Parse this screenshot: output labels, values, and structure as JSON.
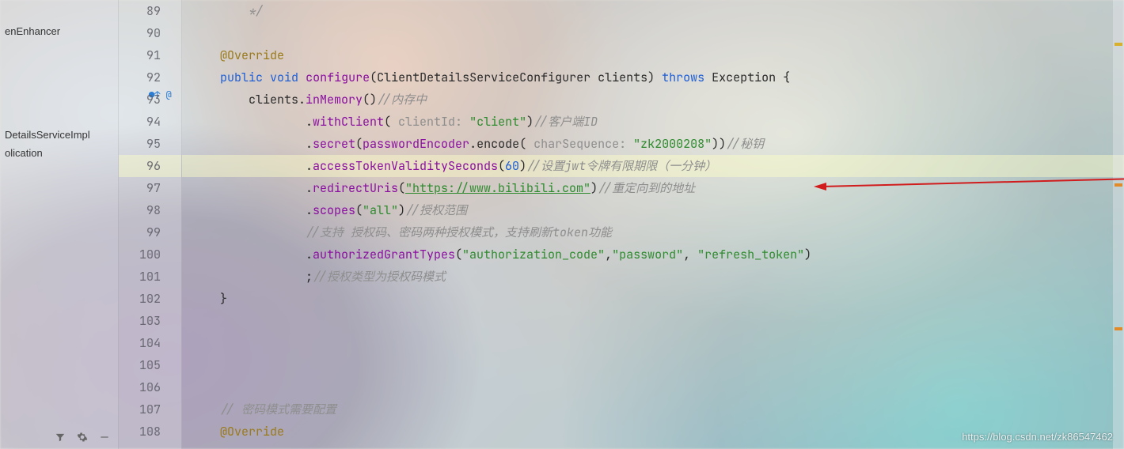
{
  "sidebar": {
    "items": [
      "enEnhancer",
      "DetailsServiceImpl",
      "olication"
    ]
  },
  "gutter": {
    "start": 89,
    "highlight": 96,
    "marks": "●↑ @"
  },
  "code": {
    "l89": "*/",
    "l91_ann": "@Override",
    "l92": {
      "kw1": "public",
      "kw2": "void",
      "mth": "configure",
      "sig": "(ClientDetailsServiceConfigurer clients)",
      "kw3": "throws",
      "exc": "Exception {"
    },
    "l93": {
      "pre": "clients.",
      "mth": "inMemory",
      "post": "()",
      "cmt": "//内存中"
    },
    "l94": {
      "mth": "withClient",
      "open": "( ",
      "param": "clientId:",
      "str": "\"client\"",
      "close": ")",
      "cmt": "//客户端ID"
    },
    "l95": {
      "mth": "secret",
      "open": "(",
      "inner": "passwordEncoder",
      "enc": ".encode( ",
      "param": "charSequence:",
      "str": "\"zk2000208\"",
      "close": "))",
      "cmt": "//秘钥"
    },
    "l96": {
      "mth": "accessTokenValiditySeconds",
      "open": "(",
      "num": "60",
      "close": ")",
      "cmt": "//设置jwt令牌有限期限（一分钟）"
    },
    "l97": {
      "mth": "redirectUris",
      "open": "(",
      "str": "\"https://www.bilibili.com\"",
      "close": ")",
      "cmt": "//重定向到的地址"
    },
    "l98": {
      "mth": "scopes",
      "open": "(",
      "str": "\"all\"",
      "close": ")",
      "cmt": "//授权范围"
    },
    "l99": {
      "cmt": "//支持 授权码、密码两种授权模式，支持刷新token功能"
    },
    "l100": {
      "mth": "authorizedGrantTypes",
      "open": "(",
      "s1": "\"authorization_code\"",
      "c1": ",",
      "s2": "\"password\"",
      "c2": ", ",
      "s3": "\"refresh_token\"",
      "close": ")"
    },
    "l101": {
      "semi": ";",
      "cmt": "//授权类型为授权码模式"
    },
    "l102": "}",
    "l107_cmt": "// 密码模式需要配置",
    "l108_ann": "@Override"
  },
  "watermark": "https://blog.csdn.net/zk86547462"
}
